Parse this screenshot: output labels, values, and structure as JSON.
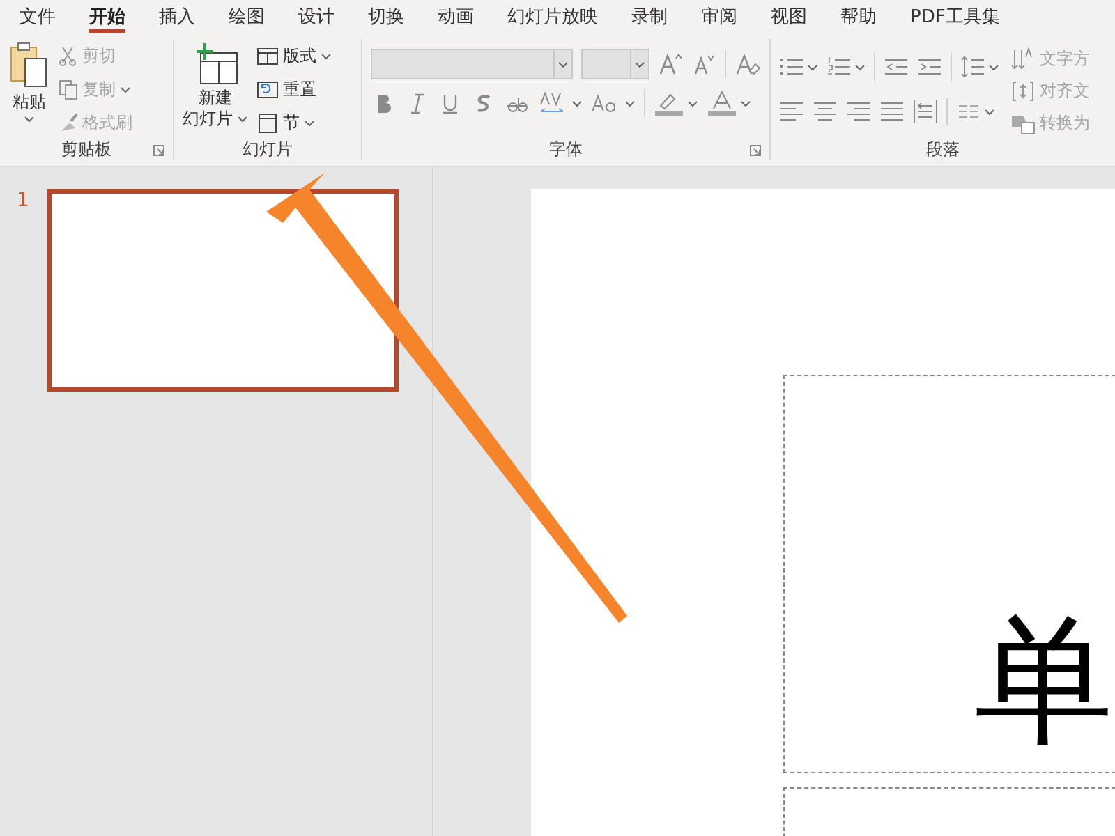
{
  "tabs": [
    {
      "label": "文件",
      "selected": false
    },
    {
      "label": "开始",
      "selected": true
    },
    {
      "label": "插入",
      "selected": false
    },
    {
      "label": "绘图",
      "selected": false
    },
    {
      "label": "设计",
      "selected": false
    },
    {
      "label": "切换",
      "selected": false
    },
    {
      "label": "动画",
      "selected": false
    },
    {
      "label": "幻灯片放映",
      "selected": false
    },
    {
      "label": "录制",
      "selected": false
    },
    {
      "label": "审阅",
      "selected": false
    },
    {
      "label": "视图",
      "selected": false
    },
    {
      "label": "帮助",
      "selected": false
    },
    {
      "label": "PDF工具集",
      "selected": false
    }
  ],
  "clipboard": {
    "paste": "粘贴",
    "label": "剪贴板",
    "buttons": [
      {
        "label": "剪切",
        "disabled": true,
        "dropdown": false
      },
      {
        "label": "复制",
        "disabled": true,
        "dropdown": true
      },
      {
        "label": "格式刷",
        "disabled": true,
        "dropdown": false
      }
    ]
  },
  "slides_group": {
    "new_slide": [
      "新建",
      "幻灯片"
    ],
    "label": "幻灯片",
    "buttons": [
      {
        "label": "版式",
        "dropdown": true
      },
      {
        "label": "重置",
        "dropdown": false
      },
      {
        "label": "节",
        "dropdown": true
      }
    ]
  },
  "font_group": {
    "label": "字体"
  },
  "paragraph_group": {
    "label": "段落",
    "buttons": [
      {
        "label": "文字方"
      },
      {
        "label": "对齐文"
      },
      {
        "label": "转换为"
      }
    ]
  },
  "slide_panel": {
    "slides": [
      {
        "number": "1",
        "selected": true
      }
    ]
  },
  "slide": {
    "title": "单"
  }
}
